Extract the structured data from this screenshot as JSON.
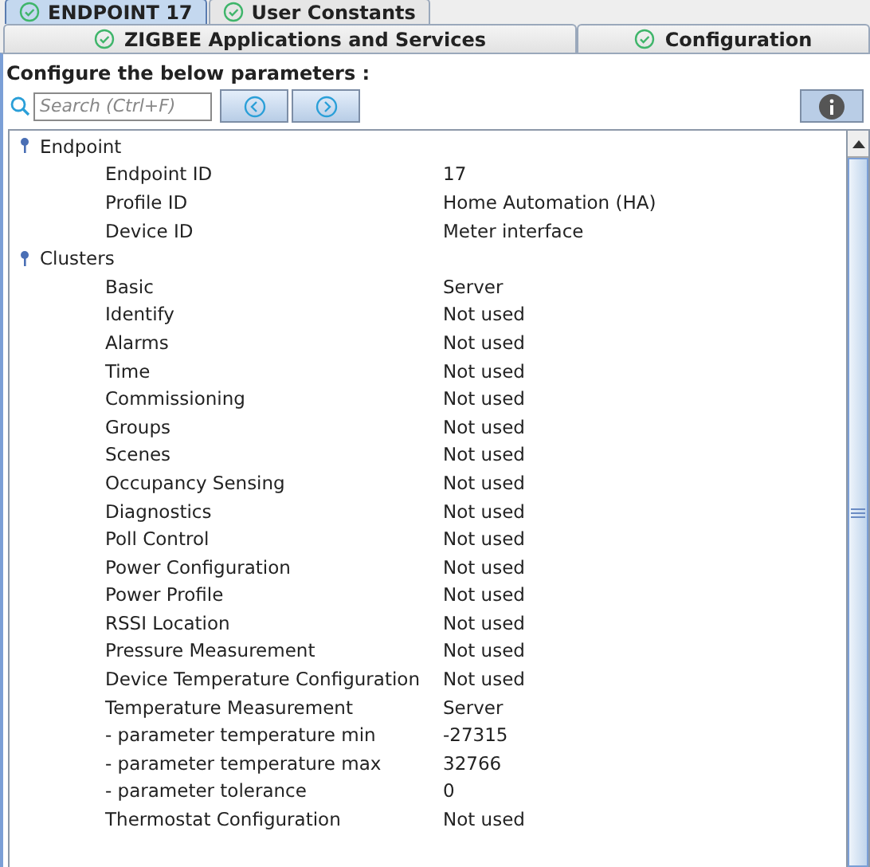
{
  "top_tabs": [
    {
      "label": "ENDPOINT 17",
      "selected": true
    },
    {
      "label": "User Constants",
      "selected": false
    }
  ],
  "sub_tabs": [
    {
      "label": "ZIGBEE Applications and Services"
    },
    {
      "label": "Configuration"
    }
  ],
  "heading": "Configure the below parameters :",
  "search": {
    "placeholder": "Search (Ctrl+F)"
  },
  "tree": [
    {
      "label": "Endpoint",
      "expanded": true,
      "children": [
        {
          "label": "Endpoint ID",
          "value": "17"
        },
        {
          "label": "Profile ID",
          "value": "Home Automation (HA)"
        },
        {
          "label": "Device ID",
          "value": "Meter interface"
        }
      ]
    },
    {
      "label": "Clusters",
      "expanded": true,
      "children": [
        {
          "label": "Basic",
          "value": "Server"
        },
        {
          "label": "Identify",
          "value": "Not used"
        },
        {
          "label": "Alarms",
          "value": "Not used"
        },
        {
          "label": "Time",
          "value": "Not used"
        },
        {
          "label": "Commissioning",
          "value": "Not used"
        },
        {
          "label": "Groups",
          "value": "Not used"
        },
        {
          "label": "Scenes",
          "value": "Not used"
        },
        {
          "label": "Occupancy Sensing",
          "value": "Not used"
        },
        {
          "label": "Diagnostics",
          "value": "Not used"
        },
        {
          "label": "Poll Control",
          "value": "Not used"
        },
        {
          "label": "Power Configuration",
          "value": "Not used"
        },
        {
          "label": "Power Profile",
          "value": "Not used"
        },
        {
          "label": "RSSI Location",
          "value": "Not used"
        },
        {
          "label": "Pressure Measurement",
          "value": "Not used"
        },
        {
          "label": "Device Temperature Configuration",
          "value": "Not used"
        },
        {
          "label": "Temperature Measurement",
          "value": "Server"
        },
        {
          "label": "- parameter temperature min",
          "value": "-27315"
        },
        {
          "label": "- parameter temperature max",
          "value": "32766"
        },
        {
          "label": "- parameter tolerance",
          "value": "0"
        },
        {
          "label": "Thermostat Configuration",
          "value": "Not used"
        }
      ]
    }
  ]
}
